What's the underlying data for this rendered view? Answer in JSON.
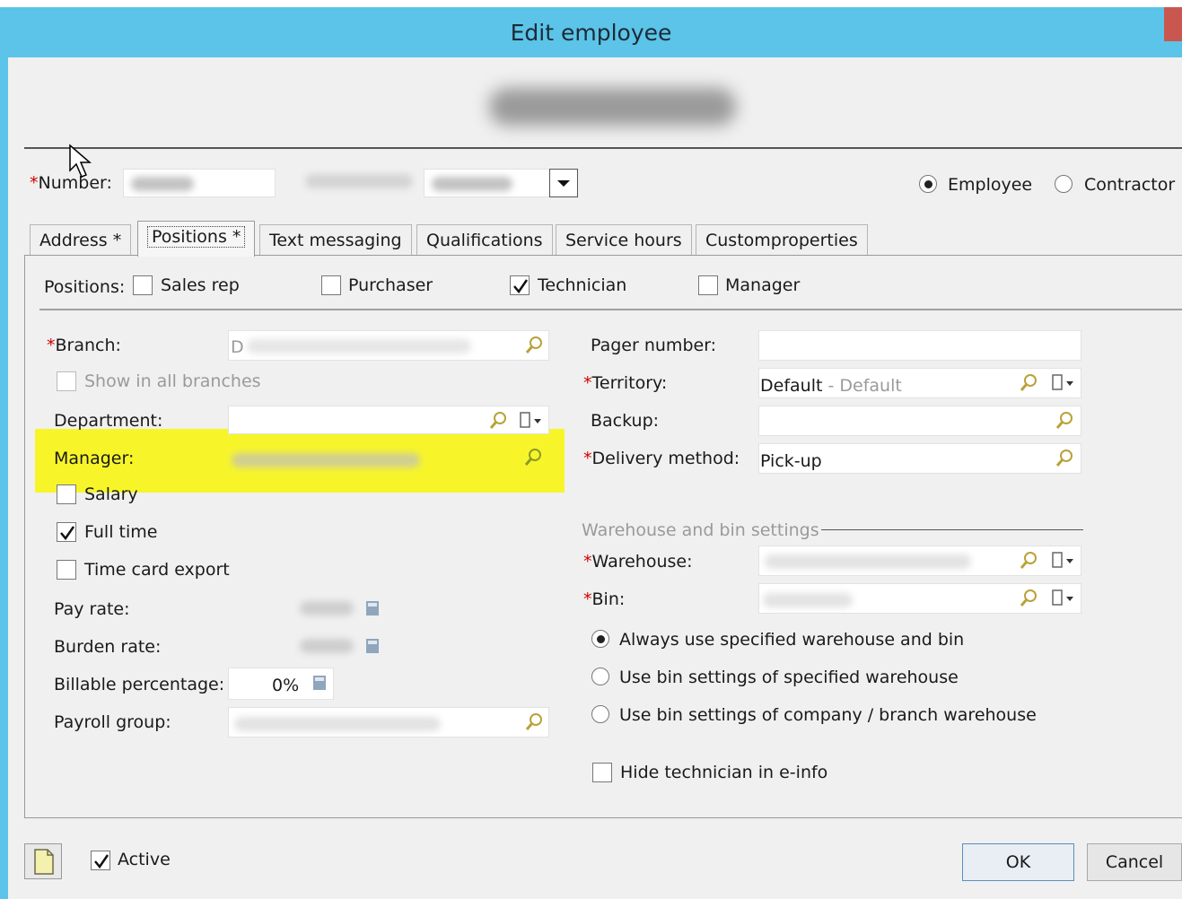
{
  "window": {
    "title": "Edit employee"
  },
  "header": {
    "number_label": "Number:",
    "employee_type_options": [
      {
        "label": "Employee",
        "selected": true
      },
      {
        "label": "Contractor",
        "selected": false
      }
    ]
  },
  "tabs": [
    {
      "label": "Address *",
      "active": false
    },
    {
      "label": "Positions *",
      "active": true
    },
    {
      "label": "Text messaging",
      "active": false
    },
    {
      "label": "Qualifications",
      "active": false
    },
    {
      "label": "Service hours",
      "active": false
    },
    {
      "label": "Customproperties",
      "active": false
    }
  ],
  "positions": {
    "label": "Positions:",
    "options": [
      {
        "label": "Sales rep",
        "checked": false
      },
      {
        "label": "Purchaser",
        "checked": false
      },
      {
        "label": "Technician",
        "checked": true
      },
      {
        "label": "Manager",
        "checked": false
      }
    ]
  },
  "left": {
    "branch_label": "Branch:",
    "branch_value": "D",
    "show_in_all_branches_label": "Show in all branches",
    "department_label": "Department:",
    "manager_label": "Manager:",
    "salary_label": "Salary",
    "salary_checked": false,
    "full_time_label": "Full time",
    "full_time_checked": true,
    "time_card_export_label": "Time card export",
    "time_card_export_checked": false,
    "pay_rate_label": "Pay rate:",
    "burden_rate_label": "Burden rate:",
    "billable_percentage_label": "Billable percentage:",
    "billable_percentage_value": "0%",
    "payroll_group_label": "Payroll group:"
  },
  "right": {
    "pager_number_label": "Pager number:",
    "territory_label": "Territory:",
    "territory_code": "Default",
    "territory_desc": " - Default",
    "backup_label": "Backup:",
    "delivery_method_label": "Delivery method:",
    "delivery_method_value": "Pick-up",
    "warehouse_section_title": "Warehouse and bin settings",
    "warehouse_label": "Warehouse:",
    "bin_label": "Bin:",
    "bin_options": [
      {
        "label": "Always use specified warehouse and bin",
        "selected": true
      },
      {
        "label": "Use bin settings of specified warehouse",
        "selected": false
      },
      {
        "label": "Use bin settings of company / branch warehouse",
        "selected": false
      }
    ],
    "hide_technician_label": "Hide technician in e-info",
    "hide_technician_checked": false
  },
  "footer": {
    "active_label": "Active",
    "active_checked": true,
    "ok_label": "OK",
    "cancel_label": "Cancel"
  },
  "colors": {
    "titlebar": "#5bc4e8",
    "highlight": "#f7f52a",
    "required_mark": "#d10000"
  }
}
